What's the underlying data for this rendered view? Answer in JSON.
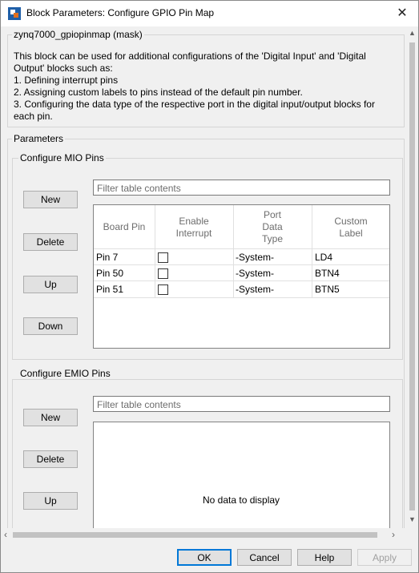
{
  "window": {
    "title": "Block Parameters: Configure GPIO Pin Map",
    "close_glyph": "✕"
  },
  "mask": {
    "legend": "zynq7000_gpiopinmap (mask)",
    "description_lines": [
      "This block can be used for additional configurations of the 'Digital Input' and 'Digital",
      "Output' blocks such as:",
      "1. Defining interrupt pins",
      "2. Assigning custom labels to pins instead of the default pin number.",
      "3. Configuring the data type of the respective port in the digital input/output blocks for",
      "each pin."
    ]
  },
  "parameters": {
    "legend": "Parameters"
  },
  "mio": {
    "legend": "Configure MIO Pins",
    "buttons": {
      "new": "New",
      "delete": "Delete",
      "up": "Up",
      "down": "Down"
    },
    "filter_placeholder": "Filter table contents",
    "columns": [
      "Board Pin",
      "Enable Interrupt",
      "Port Data Type",
      "Custom Label"
    ],
    "header_lines": {
      "board_pin": [
        "Board Pin"
      ],
      "enable_interrupt": [
        "Enable",
        "Interrupt"
      ],
      "port_data_type": [
        "Port",
        "Data",
        "Type"
      ],
      "custom_label": [
        "Custom",
        "Label"
      ]
    },
    "rows": [
      {
        "board_pin": "Pin 7",
        "enable_interrupt": false,
        "port_data_type": "-System-",
        "custom_label": "LD4"
      },
      {
        "board_pin": "Pin 50",
        "enable_interrupt": false,
        "port_data_type": "-System-",
        "custom_label": "BTN4"
      },
      {
        "board_pin": "Pin 51",
        "enable_interrupt": false,
        "port_data_type": "-System-",
        "custom_label": "BTN5"
      }
    ]
  },
  "emio": {
    "legend": "Configure EMIO Pins",
    "buttons": {
      "new": "New",
      "delete": "Delete",
      "up": "Up"
    },
    "filter_placeholder": "Filter table contents",
    "empty_text": "No data to display"
  },
  "footer": {
    "ok": "OK",
    "cancel": "Cancel",
    "help": "Help",
    "apply": "Apply"
  },
  "colors": {
    "accent": "#0078d7",
    "background": "#f0f0f0"
  }
}
